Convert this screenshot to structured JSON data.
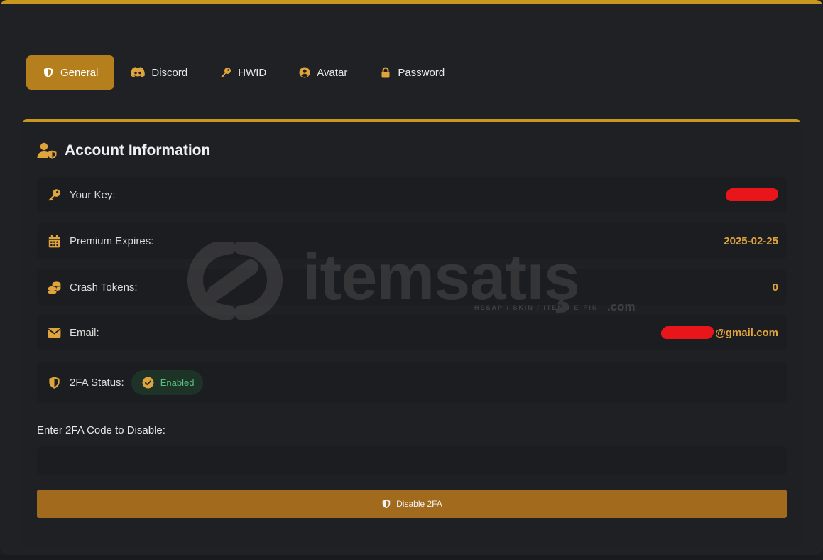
{
  "tabs": [
    {
      "label": "General",
      "icon": "shield-icon",
      "active": true
    },
    {
      "label": "Discord",
      "icon": "discord-icon",
      "active": false
    },
    {
      "label": "HWID",
      "icon": "key-icon",
      "active": false
    },
    {
      "label": "Avatar",
      "icon": "user-circle-icon",
      "active": false
    },
    {
      "label": "Password",
      "icon": "lock-icon",
      "active": false
    }
  ],
  "account": {
    "title": "Account Information",
    "rows": {
      "key": {
        "label": "Your Key:",
        "value": ""
      },
      "premium": {
        "label": "Premium Expires:",
        "value": "2025-02-25"
      },
      "tokens": {
        "label": "Crash Tokens:",
        "value": "0"
      },
      "email": {
        "label": "Email:",
        "value": "@gmail.com"
      },
      "twofa": {
        "label": "2FA Status:",
        "badge": "Enabled"
      }
    }
  },
  "disable_form": {
    "label": "Enter 2FA Code to Disable:",
    "input_value": "",
    "button_label": "Disable 2FA"
  },
  "watermark": {
    "text": "itemsatış",
    "sub": "HESAP / SKIN / ITEM / E-PIN",
    "suffix": ".com"
  },
  "colors": {
    "accent": "#c9961f",
    "active_tab": "#b67f1e",
    "value_text": "#e0a43d",
    "button": "#a16a1c",
    "enabled_green": "#58c27d"
  }
}
